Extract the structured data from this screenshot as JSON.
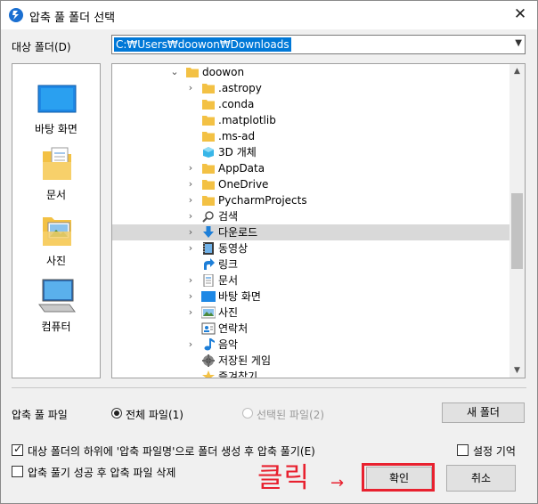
{
  "window": {
    "title": "압축 풀 폴더 선택",
    "close": "✕"
  },
  "path": {
    "label": "대상 폴더(D)",
    "value": "C:₩Users₩doowon₩Downloads"
  },
  "places": [
    {
      "label": "바탕 화면",
      "icon": "desktop-icon"
    },
    {
      "label": "문서",
      "icon": "documents-icon"
    },
    {
      "label": "사진",
      "icon": "pictures-icon"
    },
    {
      "label": "컴퓨터",
      "icon": "computer-icon"
    }
  ],
  "tree": [
    {
      "label": "doowon",
      "icon": "folder",
      "expander": "open"
    },
    {
      "label": ".astropy",
      "icon": "folder",
      "expander": "closed"
    },
    {
      "label": ".conda",
      "icon": "folder",
      "expander": "none"
    },
    {
      "label": ".matplotlib",
      "icon": "folder",
      "expander": "none"
    },
    {
      "label": ".ms-ad",
      "icon": "folder",
      "expander": "none"
    },
    {
      "label": "3D 개체",
      "icon": "3d-objects",
      "expander": "none"
    },
    {
      "label": "AppData",
      "icon": "folder",
      "expander": "closed"
    },
    {
      "label": "OneDrive",
      "icon": "folder",
      "expander": "closed"
    },
    {
      "label": "PycharmProjects",
      "icon": "folder",
      "expander": "closed"
    },
    {
      "label": "검색",
      "icon": "search",
      "expander": "closed"
    },
    {
      "label": "다운로드",
      "icon": "download",
      "expander": "closed",
      "selected": true
    },
    {
      "label": "동영상",
      "icon": "videos",
      "expander": "closed"
    },
    {
      "label": "링크",
      "icon": "link",
      "expander": "none"
    },
    {
      "label": "문서",
      "icon": "documents",
      "expander": "closed"
    },
    {
      "label": "바탕 화면",
      "icon": "desktop",
      "expander": "closed"
    },
    {
      "label": "사진",
      "icon": "pictures",
      "expander": "closed"
    },
    {
      "label": "연락처",
      "icon": "contacts",
      "expander": "none"
    },
    {
      "label": "음악",
      "icon": "music",
      "expander": "closed"
    },
    {
      "label": "저장된 게임",
      "icon": "saved-games",
      "expander": "none"
    },
    {
      "label": "즐겨찾기",
      "icon": "favorites",
      "expander": "none"
    }
  ],
  "options": {
    "file_label": "압축 풀 파일",
    "radio_all": "전체 파일(1)",
    "radio_selected": "선택된 파일(2)",
    "new_folder": "새 폴더",
    "check_subfolder": "대상 폴더의 하위에 '압축 파일명'으로 폴더 생성 후 압축 풀기(E)",
    "check_subfolder_on": true,
    "check_remember": "설정 기억",
    "check_delete": "압축 풀기 성공 후 압축 파일 삭제",
    "ok": "확인",
    "cancel": "취소"
  },
  "annotation": {
    "text": "클릭",
    "arrow": "→"
  },
  "colors": {
    "selection": "#0078d7",
    "annotation": "#e8212f",
    "folder": "#f3c144"
  }
}
